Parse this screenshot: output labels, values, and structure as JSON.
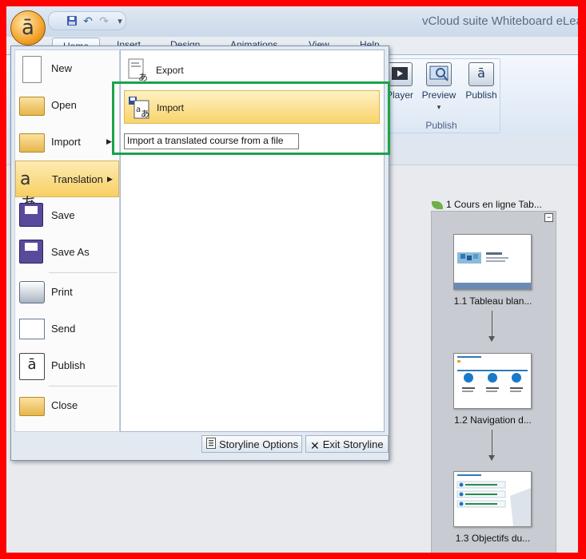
{
  "colors": {
    "frame": "#ff0000",
    "highlight_box": "#1aa34a",
    "menu_hover": "#f8cf63"
  },
  "window": {
    "title": "vCloud suite Whiteboard eLea"
  },
  "app_button": {
    "glyph": "ā",
    "icon": "whiteboard-icon"
  },
  "quick_access": {
    "save_icon": "save-icon",
    "undo_glyph": "↶",
    "redo_glyph": "↷",
    "dropdown_glyph": "▾"
  },
  "ribbon_tabs": [
    "Home",
    "Insert",
    "Design",
    "Animations",
    "View",
    "Help"
  ],
  "ribbon": {
    "publish_group": {
      "label": "Publish",
      "buttons": [
        {
          "label": "Player",
          "icon": "player-icon"
        },
        {
          "label": "Preview",
          "icon": "preview-icon",
          "dropdown": "▾"
        },
        {
          "label": "Publish",
          "icon": "publish-icon"
        }
      ]
    }
  },
  "app_menu": {
    "left_items": [
      {
        "label": "New",
        "icon": "new-document-icon"
      },
      {
        "label": "Open",
        "icon": "open-folder-icon"
      },
      {
        "label": "Import",
        "icon": "import-folder-icon",
        "submenu": true
      },
      {
        "label": "Translation",
        "icon": "translation-icon",
        "submenu": true,
        "selected": true
      },
      {
        "label": "Save",
        "icon": "save-icon"
      },
      {
        "label": "Save As",
        "icon": "save-as-icon"
      },
      {
        "label": "Print",
        "icon": "printer-icon"
      },
      {
        "label": "Send",
        "icon": "send-icon"
      },
      {
        "label": "Publish",
        "icon": "publish-icon"
      },
      {
        "label": "Close",
        "icon": "close-folder-icon"
      }
    ],
    "right_items": [
      {
        "label": "Export",
        "icon": "export-translation-icon"
      },
      {
        "label": "Import",
        "icon": "import-translation-icon",
        "hovered": true
      }
    ],
    "tooltip": "Import a translated course from a file",
    "footer": {
      "options_label": "Storyline Options",
      "exit_label": "Exit Storyline",
      "exit_glyph": "✕"
    }
  },
  "story_map": {
    "scene_title": "1 Cours en ligne Tab...",
    "collapse_glyph": "−",
    "slides": [
      {
        "label": "1.1 Tableau blan..."
      },
      {
        "label": "1.2 Navigation d..."
      },
      {
        "label": "1.3 Objectifs du..."
      }
    ]
  }
}
